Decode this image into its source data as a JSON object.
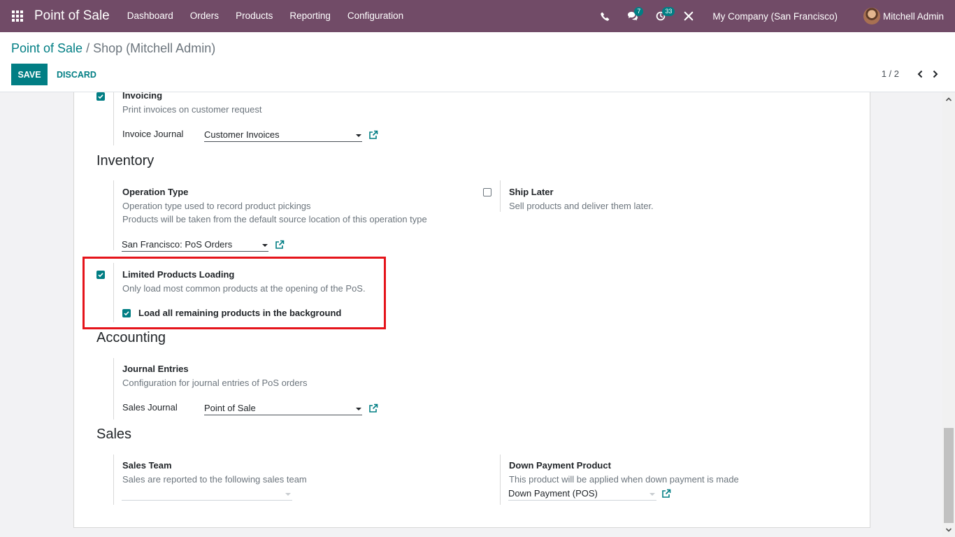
{
  "navbar": {
    "brand": "Point of Sale",
    "menu": [
      "Dashboard",
      "Orders",
      "Products",
      "Reporting",
      "Configuration"
    ],
    "messages_count": "7",
    "activities_count": "33",
    "company": "My Company (San Francisco)",
    "user": "Mitchell Admin"
  },
  "breadcrumb": {
    "parent": "Point of Sale",
    "separator": "/",
    "current": "Shop (Mitchell Admin)"
  },
  "actions": {
    "save": "SAVE",
    "discard": "DISCARD"
  },
  "pager": {
    "value": "1 / 2"
  },
  "invoicing": {
    "title": "Invoicing",
    "checked": true,
    "description": "Print invoices on customer request",
    "journal_label": "Invoice Journal",
    "journal_value": "Customer Invoices"
  },
  "inventory": {
    "heading": "Inventory",
    "operation_type": {
      "title": "Operation Type",
      "desc1": "Operation type used to record product pickings",
      "desc2": "Products will be taken from the default source location of this operation type",
      "value": "San Francisco: PoS Orders"
    },
    "ship_later": {
      "title": "Ship Later",
      "checked": false,
      "description": "Sell products and deliver them later."
    },
    "limited_loading": {
      "title": "Limited Products Loading",
      "checked": true,
      "description": "Only load most common products at the opening of the PoS.",
      "sub_option": "Load all remaining products in the background",
      "sub_checked": true
    }
  },
  "accounting": {
    "heading": "Accounting",
    "journal_entries": {
      "title": "Journal Entries",
      "description": "Configuration for journal entries of PoS orders",
      "sales_journal_label": "Sales Journal",
      "sales_journal_value": "Point of Sale"
    }
  },
  "sales": {
    "heading": "Sales",
    "sales_team": {
      "title": "Sales Team",
      "description": "Sales are reported to the following sales team",
      "value": ""
    },
    "down_payment": {
      "title": "Down Payment Product",
      "description": "This product will be applied when down payment is made",
      "value": "Down Payment (POS)"
    }
  },
  "colors": {
    "navbar": "#714b67",
    "primary": "#017e84",
    "highlight": "#e5141b"
  }
}
